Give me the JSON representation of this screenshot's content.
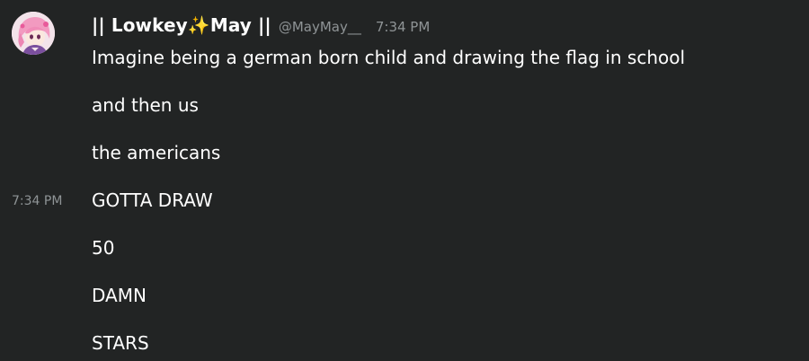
{
  "author": {
    "name_prefix": "|| Lowkey",
    "name_emoji": "✨",
    "name_suffix": "May ||",
    "handle": "@MayMay__",
    "timestamp": "7:34 PM"
  },
  "hover_timestamp": "7:34 PM",
  "messages": [
    "Imagine being a german born child and drawing the flag in school",
    "and then us",
    "the americans",
    "GOTTA DRAW",
    "50",
    "DAMN",
    "STARS"
  ],
  "colors": {
    "background": "#222424",
    "text": "#ffffff",
    "muted": "#8f9496",
    "sparkle": "#f5c542"
  }
}
